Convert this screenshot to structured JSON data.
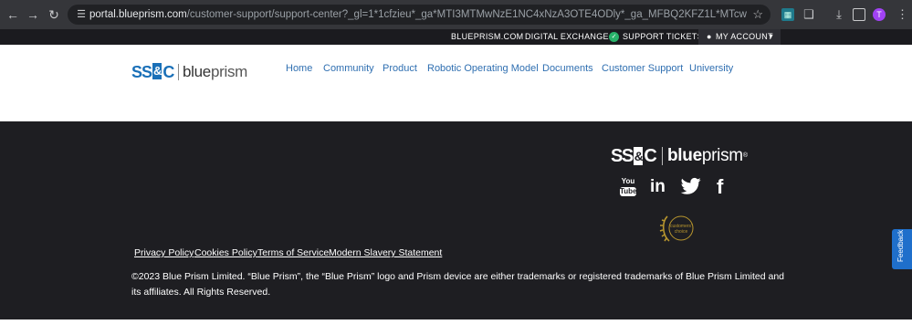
{
  "browser": {
    "back_icon": "arrow-left-icon",
    "forward_icon": "arrow-right-icon",
    "reload_icon": "reload-icon",
    "url_domain": "portal.blueprism.com",
    "url_path": "/customer-support/support-center?_gl=1*1cfzieu*_ga*MTI3MTMwNzE1NC4xNzA3OTE4ODly*_ga_MFBQ2KFZ1L*MTcwODMzNTE1NS4xNy4xLjE3MDgzMzUyNjkuMjY...",
    "profile_initial": "T"
  },
  "utility_bar": {
    "blueprism_com": "BLUEPRISM.COM",
    "digital_exchange": "DIGITAL EXCHANGE",
    "support_tickets": "SUPPORT TICKETS",
    "my_account": "MY ACCOUNT"
  },
  "header": {
    "logo_ssc_a": "SS",
    "logo_ssc_amp": "&",
    "logo_ssc_b": "C",
    "logo_blue": "blue",
    "logo_prism": "prism",
    "nav": [
      "Home",
      "Community",
      "Product",
      "Robotic Operating Model",
      "Documents",
      "Customer Support",
      "University"
    ]
  },
  "footer": {
    "logo_ssc_a": "SS",
    "logo_ssc_amp": "&",
    "logo_ssc_b": "C",
    "logo_blue": "blue",
    "logo_prism": "prism",
    "social": {
      "youtube_you": "You",
      "youtube_tube": "Tube",
      "linkedin": "in",
      "facebook": "f"
    },
    "badge_text_top": "customers'",
    "badge_text_bottom": "choice",
    "links": [
      "Privacy Policy",
      "Cookies Policy",
      "Terms of Service",
      "Modern Slavery Statement"
    ],
    "copyright": "©2023 Blue Prism Limited. “Blue Prism”, the “Blue Prism” logo and Prism device are either trademarks or registered trademarks of Blue Prism Limited and its affiliates. All Rights Reserved."
  },
  "feedback_label": "Feedback",
  "colors": {
    "brand_blue": "#1a70b8",
    "nav_link": "#2f6fb1",
    "footer_bg": "#1e1e22",
    "utility_bg": "#1b1b1f",
    "feedback_bg": "#1f6fcb"
  }
}
